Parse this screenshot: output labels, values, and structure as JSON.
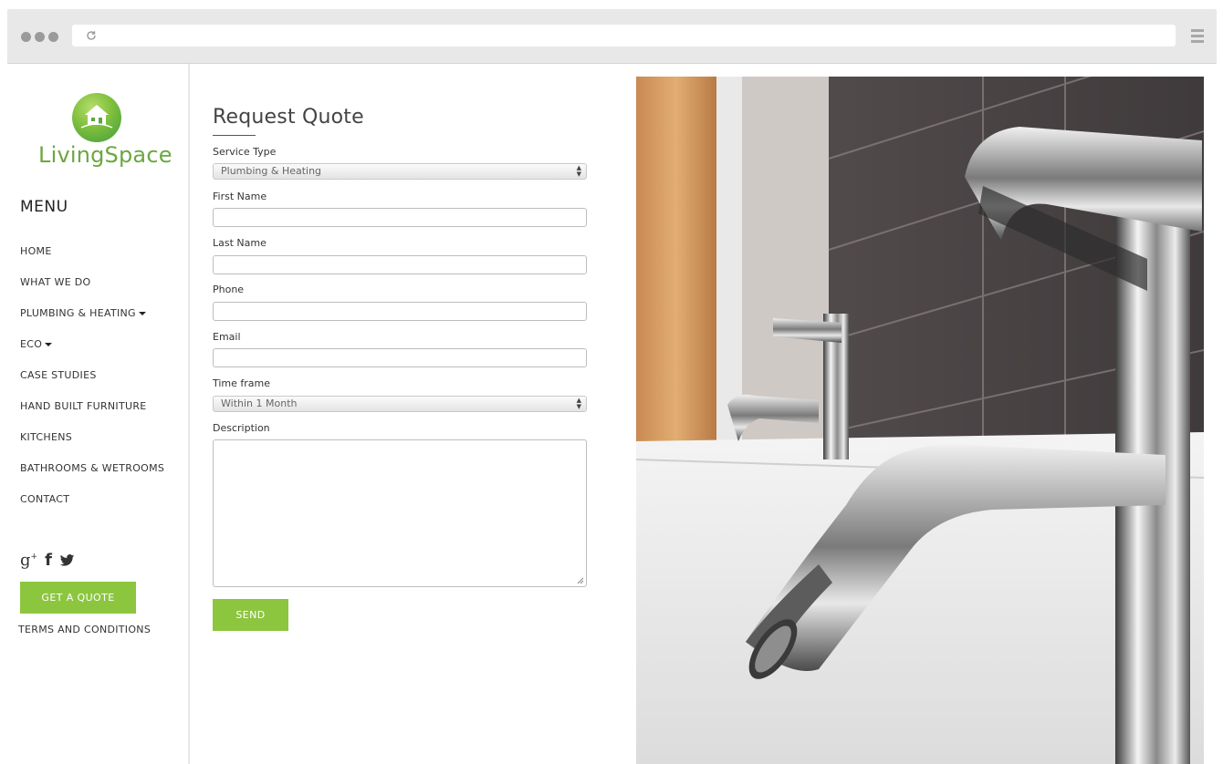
{
  "brand": {
    "name": "LivingSpace"
  },
  "sidebar": {
    "menu_title": "MENU",
    "items": [
      {
        "label": "HOME",
        "dropdown": false
      },
      {
        "label": "WHAT WE DO",
        "dropdown": false
      },
      {
        "label": "PLUMBING & HEATING",
        "dropdown": true
      },
      {
        "label": "ECO",
        "dropdown": true
      },
      {
        "label": "CASE STUDIES",
        "dropdown": false
      },
      {
        "label": "HAND BUILT FURNITURE",
        "dropdown": false
      },
      {
        "label": "KITCHENS",
        "dropdown": false
      },
      {
        "label": "BATHROOMS & WETROOMS",
        "dropdown": false
      },
      {
        "label": "CONTACT",
        "dropdown": false
      }
    ],
    "social": [
      "google-plus-icon",
      "facebook-icon",
      "twitter-icon"
    ],
    "quote_button": "GET A QUOTE",
    "terms_link": "TERMS AND CONDITIONS"
  },
  "form": {
    "title": "Request Quote",
    "service_type": {
      "label": "Service Type",
      "value": "Plumbing & Heating"
    },
    "first_name": {
      "label": "First Name",
      "value": ""
    },
    "last_name": {
      "label": "Last Name",
      "value": ""
    },
    "phone": {
      "label": "Phone",
      "value": ""
    },
    "email": {
      "label": "Email",
      "value": ""
    },
    "time_frame": {
      "label": "Time frame",
      "value": "Within 1 Month"
    },
    "description": {
      "label": "Description",
      "value": ""
    },
    "send_button": "SEND"
  },
  "colors": {
    "accent": "#8cc63f",
    "logo_text": "#6aa83f"
  }
}
